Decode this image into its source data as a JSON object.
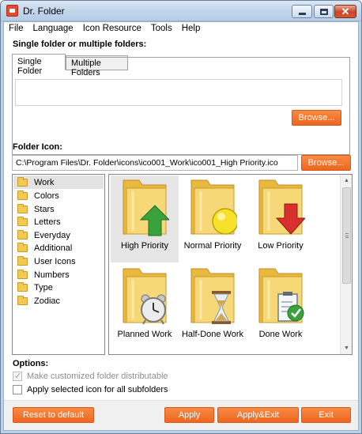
{
  "window": {
    "title": "Dr. Folder"
  },
  "menu": [
    "File",
    "Language",
    "Icon Resource",
    "Tools",
    "Help"
  ],
  "folders_section": {
    "label": "Single folder or multiple folders:",
    "tabs": [
      "Single Folder",
      "Multiple Folders"
    ],
    "browse_label": "Browse..."
  },
  "icon_section": {
    "label": "Folder Icon:",
    "path": "C:\\Program Files\\Dr. Folder\\icons\\ico001_Work\\ico001_High Priority.ico",
    "browse_label": "Browse..."
  },
  "categories": [
    "Work",
    "Colors",
    "Stars",
    "Letters",
    "Everyday",
    "Additional",
    "User Icons",
    "Numbers",
    "Type",
    "Zodiac"
  ],
  "icons": [
    {
      "label": "High Priority",
      "icon": "up-arrow-icon"
    },
    {
      "label": "Normal Priority",
      "icon": "circle-icon"
    },
    {
      "label": "Low Priority",
      "icon": "down-arrow-icon"
    },
    {
      "label": "Planned Work",
      "icon": "alarm-clock-icon"
    },
    {
      "label": "Half-Done Work",
      "icon": "hourglass-icon"
    },
    {
      "label": "Done Work",
      "icon": "checklist-icon"
    }
  ],
  "options": {
    "label": "Options:",
    "distributable": "Make customized folder distributable",
    "subfolders": "Apply selected icon for all subfolders"
  },
  "buttons": {
    "reset": "Reset to default",
    "apply": "Apply",
    "apply_exit": "Apply&Exit",
    "exit": "Exit"
  },
  "colors": {
    "accent": "#f27a31",
    "folder": "#f3c853",
    "selection": "#e6e6e6"
  }
}
